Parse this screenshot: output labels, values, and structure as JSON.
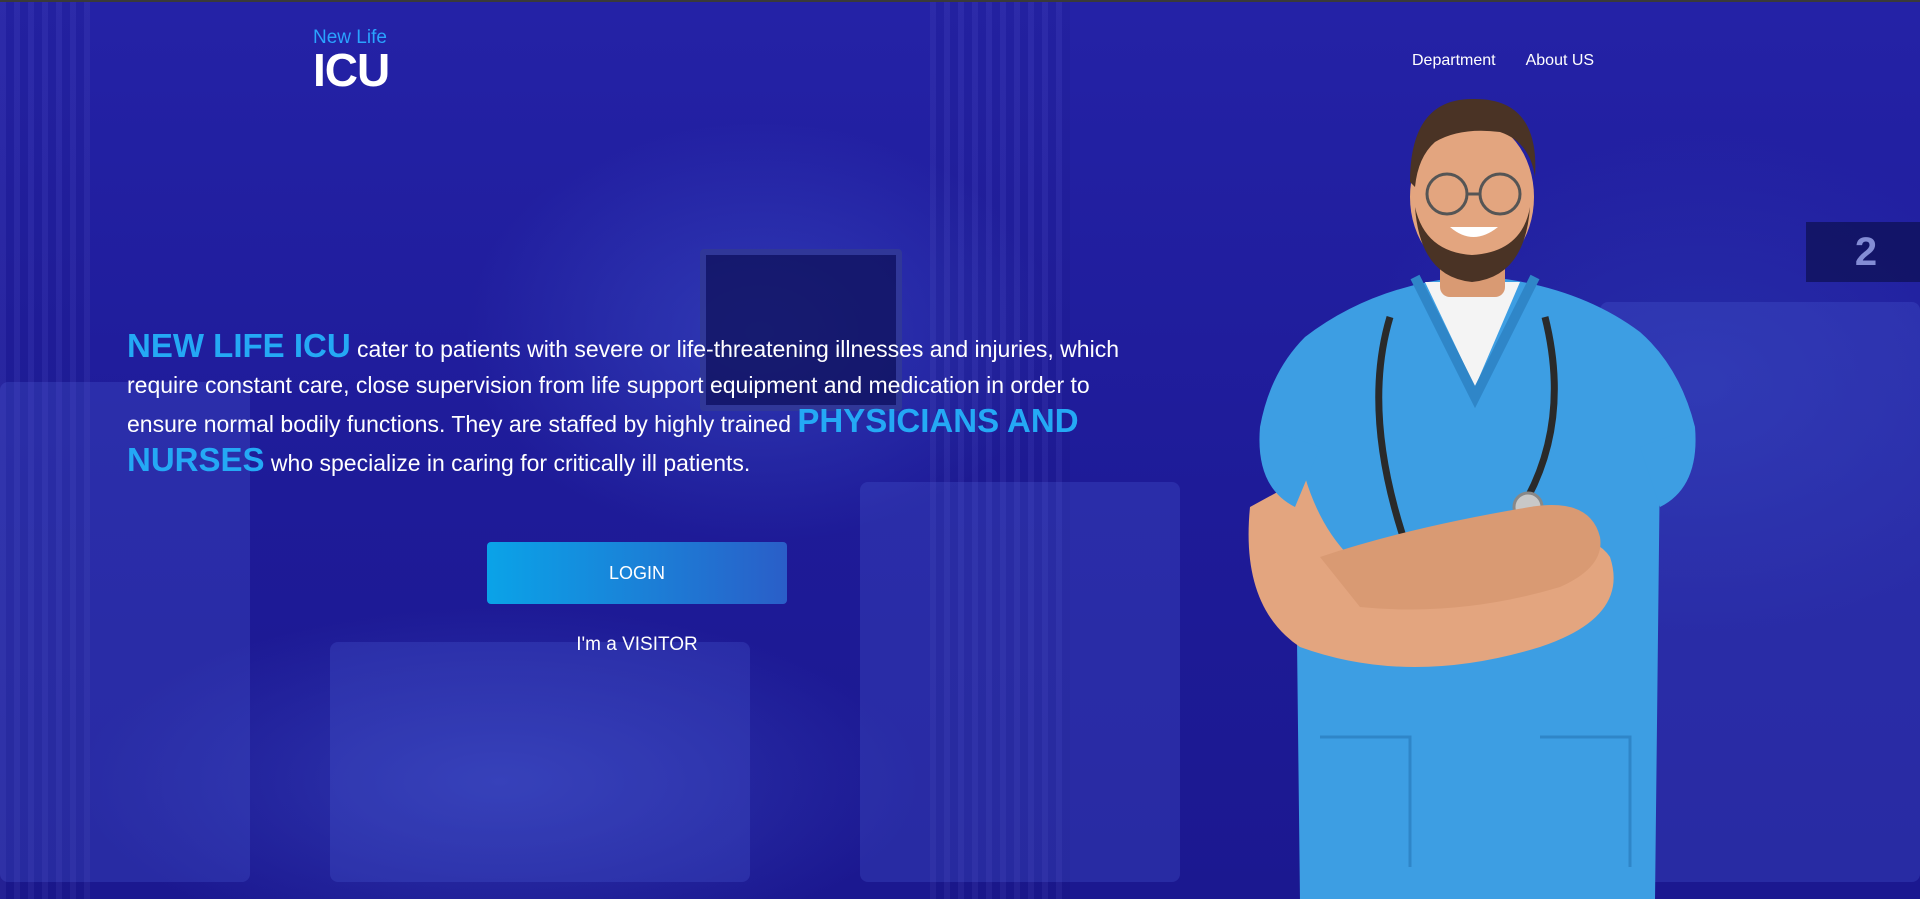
{
  "header": {
    "logo_top": "New Life",
    "logo_main": "ICU",
    "nav": [
      {
        "label": "Department"
      },
      {
        "label": "About US"
      }
    ]
  },
  "hero": {
    "highlight_1": "NEW LIFE ICU",
    "text_1": " cater to patients with severe or life-threatening illnesses and injuries, which require constant care, close supervision from life support equipment and medication in order to ensure normal bodily functions. They are staffed by highly trained ",
    "highlight_2": "PHYSICIANS AND NURSES",
    "text_2": " who specialize in caring for critically ill patients."
  },
  "actions": {
    "login_label": "LOGIN",
    "visitor_label": "I'm a VISITOR"
  },
  "background": {
    "ward_sign": "2"
  },
  "colors": {
    "background": "#1f1c9a",
    "accent": "#24a9f5",
    "scrubs": "#3d9ee3",
    "text": "#ffffff"
  }
}
